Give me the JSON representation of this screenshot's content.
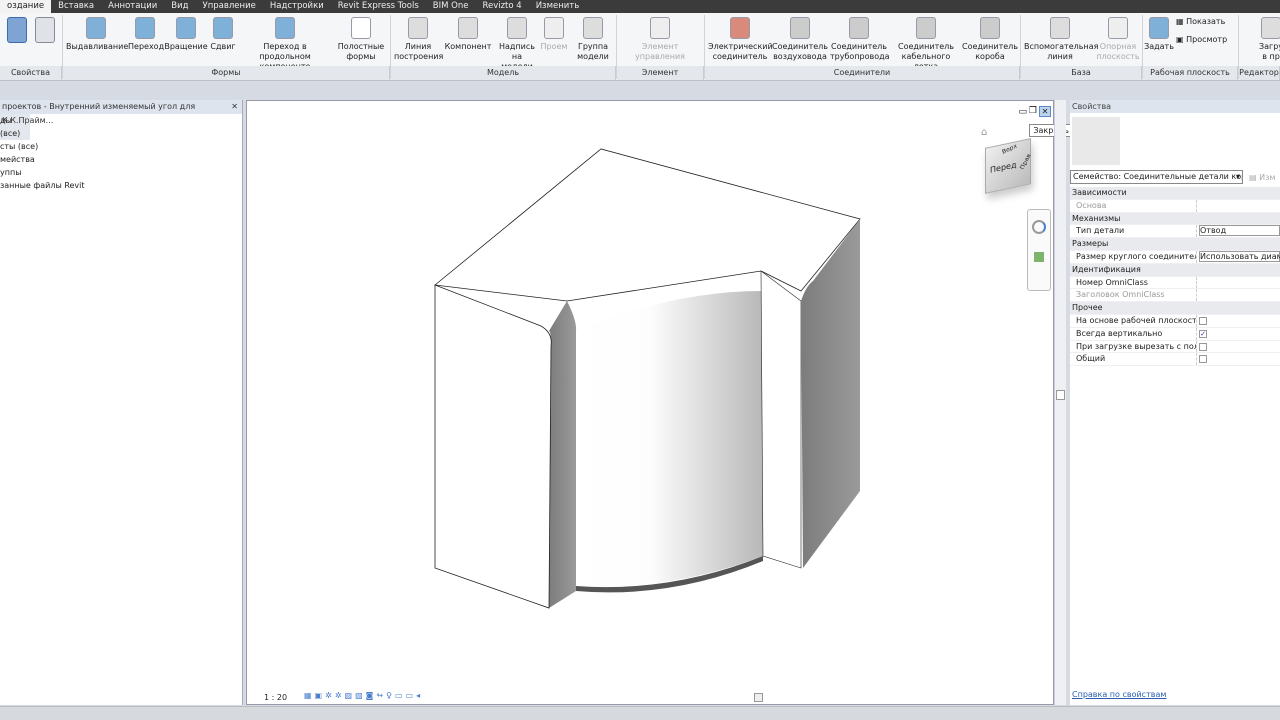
{
  "menu": [
    "оздание",
    "Вставка",
    "Аннотации",
    "Вид",
    "Управление",
    "Надстройки",
    "Revit Express Tools",
    "BIM One",
    "Revizto 4",
    "Изменить"
  ],
  "ribbon": {
    "tools": [
      {
        "l1": "Выдавливание",
        "l2": ""
      },
      {
        "l1": "Переход",
        "l2": ""
      },
      {
        "l1": "Вращение",
        "l2": ""
      },
      {
        "l1": "Сдвиг",
        "l2": ""
      },
      {
        "l1": "Переход в продольном",
        "l2": "компоненте"
      },
      {
        "l1": "Полостные",
        "l2": "формы"
      },
      {
        "l1": "Линия",
        "l2": "построения"
      },
      {
        "l1": "Компонент",
        "l2": ""
      },
      {
        "l1": "Надпись",
        "l2": "на модели"
      },
      {
        "l1": "Проем",
        "l2": ""
      },
      {
        "l1": "Группа",
        "l2": "модели"
      },
      {
        "l1": "Элемент управления",
        "l2": ""
      },
      {
        "l1": "Электрический",
        "l2": "соединитель"
      },
      {
        "l1": "Соединитель",
        "l2": "воздуховода"
      },
      {
        "l1": "Соединитель",
        "l2": "трубопровода"
      },
      {
        "l1": "Соединитель",
        "l2": "кабельного лотка"
      },
      {
        "l1": "Соединитель",
        "l2": "короба"
      },
      {
        "l1": "Вспомогательная",
        "l2": "линия"
      },
      {
        "l1": "Опорная",
        "l2": "плоскость"
      },
      {
        "l1": "Задать",
        "l2": ""
      },
      {
        "l1": "Загру",
        "l2": "в пр"
      }
    ],
    "show": "Показать",
    "preview": "Просмотр",
    "groups": [
      "Свойства",
      "Формы",
      "Модель",
      "Элемент управления",
      "Соединители",
      "База",
      "Рабочая плоскость",
      "Редактор"
    ]
  },
  "browser": {
    "title": "проектов - Внутренний изменяемый угол для К.К.Прайм...",
    "items": [
      "ды (все)",
      "сты (все)",
      "мейства",
      "уппы",
      "занные файлы Revit"
    ]
  },
  "view": {
    "close_tooltip": "Закрыть",
    "cube_front": "Перед",
    "cube_top": "Верх",
    "cube_right": "Прав",
    "scale": "1 : 20"
  },
  "props": {
    "title": "Свойства",
    "family": "Семейство: Соединительные детали кор",
    "edit_type": "Изм",
    "rows": [
      {
        "cat": "Зависимости"
      },
      {
        "k": "Основа",
        "v": "",
        "gray": true
      },
      {
        "cat": "Механизмы"
      },
      {
        "k": "Тип детали",
        "v": "Отвод"
      },
      {
        "cat": "Размеры"
      },
      {
        "k": "Размер круглого соединителя",
        "v": "Использовать диаме"
      },
      {
        "cat": "Идентификация"
      },
      {
        "k": "Номер OmniClass",
        "v": ""
      },
      {
        "k": "Заголовок OmniClass",
        "v": "",
        "gray": true
      },
      {
        "cat": "Прочее"
      },
      {
        "k": "На основе рабочей плоскости",
        "check": false
      },
      {
        "k": "Всегда вертикально",
        "check": true
      },
      {
        "k": "При загрузке вырезать с пол...",
        "check": false
      },
      {
        "k": "Общий",
        "check": false
      }
    ],
    "help": "Справка по свойствам"
  }
}
